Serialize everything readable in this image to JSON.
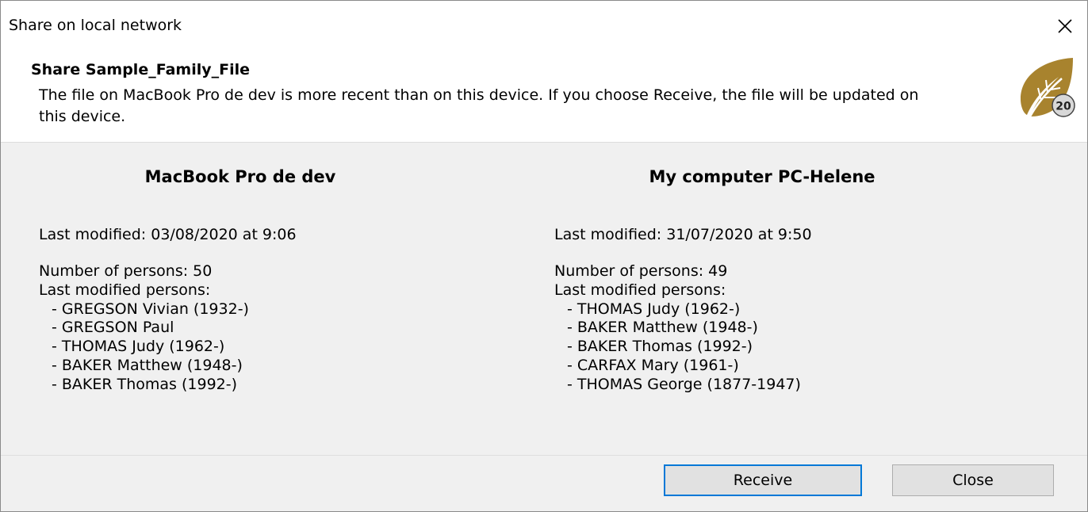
{
  "window": {
    "title": "Share on local network"
  },
  "header": {
    "title": "Share Sample_Family_File",
    "description": "The file on  MacBook Pro de dev is more recent than on this device. If you choose Receive, the file will be updated on this device.",
    "logo_text": "20"
  },
  "colors": {
    "accent": "#0078d7",
    "logo_gold": "#a8832e"
  },
  "remote": {
    "name": "MacBook Pro de dev",
    "last_modified": "Last modified: 03/08/2020 at 9:06",
    "number_of_persons": "Number of persons: 50",
    "last_modified_persons_label": "Last modified persons:",
    "persons": [
      "- GREGSON Vivian (1932-)",
      "- GREGSON Paul",
      "- THOMAS Judy (1962-)",
      "- BAKER Matthew (1948-)",
      "- BAKER Thomas (1992-)"
    ]
  },
  "local": {
    "name": "My computer PC-Helene",
    "last_modified": "Last modified: 31/07/2020 at 9:50",
    "number_of_persons": "Number of persons: 49",
    "last_modified_persons_label": "Last modified persons:",
    "persons": [
      "- THOMAS Judy (1962-)",
      "- BAKER Matthew (1948-)",
      "- BAKER Thomas (1992-)",
      "- CARFAX Mary (1961-)",
      "- THOMAS George (1877-1947)"
    ]
  },
  "buttons": {
    "receive_label": "Receive",
    "close_label": "Close"
  }
}
